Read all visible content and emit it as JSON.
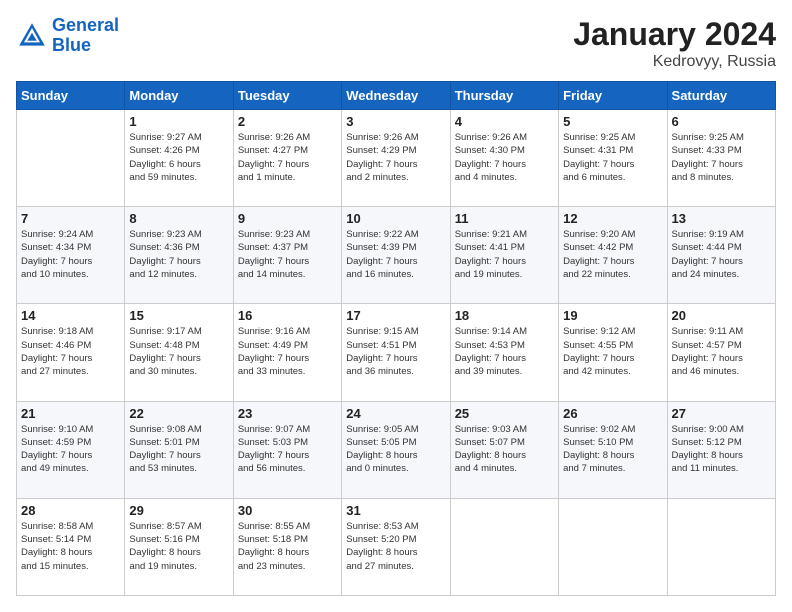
{
  "logo": {
    "line1": "General",
    "line2": "Blue"
  },
  "title": "January 2024",
  "location": "Kedrovyy, Russia",
  "days_header": [
    "Sunday",
    "Monday",
    "Tuesday",
    "Wednesday",
    "Thursday",
    "Friday",
    "Saturday"
  ],
  "weeks": [
    [
      {
        "num": "",
        "info": ""
      },
      {
        "num": "1",
        "info": "Sunrise: 9:27 AM\nSunset: 4:26 PM\nDaylight: 6 hours\nand 59 minutes."
      },
      {
        "num": "2",
        "info": "Sunrise: 9:26 AM\nSunset: 4:27 PM\nDaylight: 7 hours\nand 1 minute."
      },
      {
        "num": "3",
        "info": "Sunrise: 9:26 AM\nSunset: 4:29 PM\nDaylight: 7 hours\nand 2 minutes."
      },
      {
        "num": "4",
        "info": "Sunrise: 9:26 AM\nSunset: 4:30 PM\nDaylight: 7 hours\nand 4 minutes."
      },
      {
        "num": "5",
        "info": "Sunrise: 9:25 AM\nSunset: 4:31 PM\nDaylight: 7 hours\nand 6 minutes."
      },
      {
        "num": "6",
        "info": "Sunrise: 9:25 AM\nSunset: 4:33 PM\nDaylight: 7 hours\nand 8 minutes."
      }
    ],
    [
      {
        "num": "7",
        "info": "Sunrise: 9:24 AM\nSunset: 4:34 PM\nDaylight: 7 hours\nand 10 minutes."
      },
      {
        "num": "8",
        "info": "Sunrise: 9:23 AM\nSunset: 4:36 PM\nDaylight: 7 hours\nand 12 minutes."
      },
      {
        "num": "9",
        "info": "Sunrise: 9:23 AM\nSunset: 4:37 PM\nDaylight: 7 hours\nand 14 minutes."
      },
      {
        "num": "10",
        "info": "Sunrise: 9:22 AM\nSunset: 4:39 PM\nDaylight: 7 hours\nand 16 minutes."
      },
      {
        "num": "11",
        "info": "Sunrise: 9:21 AM\nSunset: 4:41 PM\nDaylight: 7 hours\nand 19 minutes."
      },
      {
        "num": "12",
        "info": "Sunrise: 9:20 AM\nSunset: 4:42 PM\nDaylight: 7 hours\nand 22 minutes."
      },
      {
        "num": "13",
        "info": "Sunrise: 9:19 AM\nSunset: 4:44 PM\nDaylight: 7 hours\nand 24 minutes."
      }
    ],
    [
      {
        "num": "14",
        "info": "Sunrise: 9:18 AM\nSunset: 4:46 PM\nDaylight: 7 hours\nand 27 minutes."
      },
      {
        "num": "15",
        "info": "Sunrise: 9:17 AM\nSunset: 4:48 PM\nDaylight: 7 hours\nand 30 minutes."
      },
      {
        "num": "16",
        "info": "Sunrise: 9:16 AM\nSunset: 4:49 PM\nDaylight: 7 hours\nand 33 minutes."
      },
      {
        "num": "17",
        "info": "Sunrise: 9:15 AM\nSunset: 4:51 PM\nDaylight: 7 hours\nand 36 minutes."
      },
      {
        "num": "18",
        "info": "Sunrise: 9:14 AM\nSunset: 4:53 PM\nDaylight: 7 hours\nand 39 minutes."
      },
      {
        "num": "19",
        "info": "Sunrise: 9:12 AM\nSunset: 4:55 PM\nDaylight: 7 hours\nand 42 minutes."
      },
      {
        "num": "20",
        "info": "Sunrise: 9:11 AM\nSunset: 4:57 PM\nDaylight: 7 hours\nand 46 minutes."
      }
    ],
    [
      {
        "num": "21",
        "info": "Sunrise: 9:10 AM\nSunset: 4:59 PM\nDaylight: 7 hours\nand 49 minutes."
      },
      {
        "num": "22",
        "info": "Sunrise: 9:08 AM\nSunset: 5:01 PM\nDaylight: 7 hours\nand 53 minutes."
      },
      {
        "num": "23",
        "info": "Sunrise: 9:07 AM\nSunset: 5:03 PM\nDaylight: 7 hours\nand 56 minutes."
      },
      {
        "num": "24",
        "info": "Sunrise: 9:05 AM\nSunset: 5:05 PM\nDaylight: 8 hours\nand 0 minutes."
      },
      {
        "num": "25",
        "info": "Sunrise: 9:03 AM\nSunset: 5:07 PM\nDaylight: 8 hours\nand 4 minutes."
      },
      {
        "num": "26",
        "info": "Sunrise: 9:02 AM\nSunset: 5:10 PM\nDaylight: 8 hours\nand 7 minutes."
      },
      {
        "num": "27",
        "info": "Sunrise: 9:00 AM\nSunset: 5:12 PM\nDaylight: 8 hours\nand 11 minutes."
      }
    ],
    [
      {
        "num": "28",
        "info": "Sunrise: 8:58 AM\nSunset: 5:14 PM\nDaylight: 8 hours\nand 15 minutes."
      },
      {
        "num": "29",
        "info": "Sunrise: 8:57 AM\nSunset: 5:16 PM\nDaylight: 8 hours\nand 19 minutes."
      },
      {
        "num": "30",
        "info": "Sunrise: 8:55 AM\nSunset: 5:18 PM\nDaylight: 8 hours\nand 23 minutes."
      },
      {
        "num": "31",
        "info": "Sunrise: 8:53 AM\nSunset: 5:20 PM\nDaylight: 8 hours\nand 27 minutes."
      },
      {
        "num": "",
        "info": ""
      },
      {
        "num": "",
        "info": ""
      },
      {
        "num": "",
        "info": ""
      }
    ]
  ]
}
